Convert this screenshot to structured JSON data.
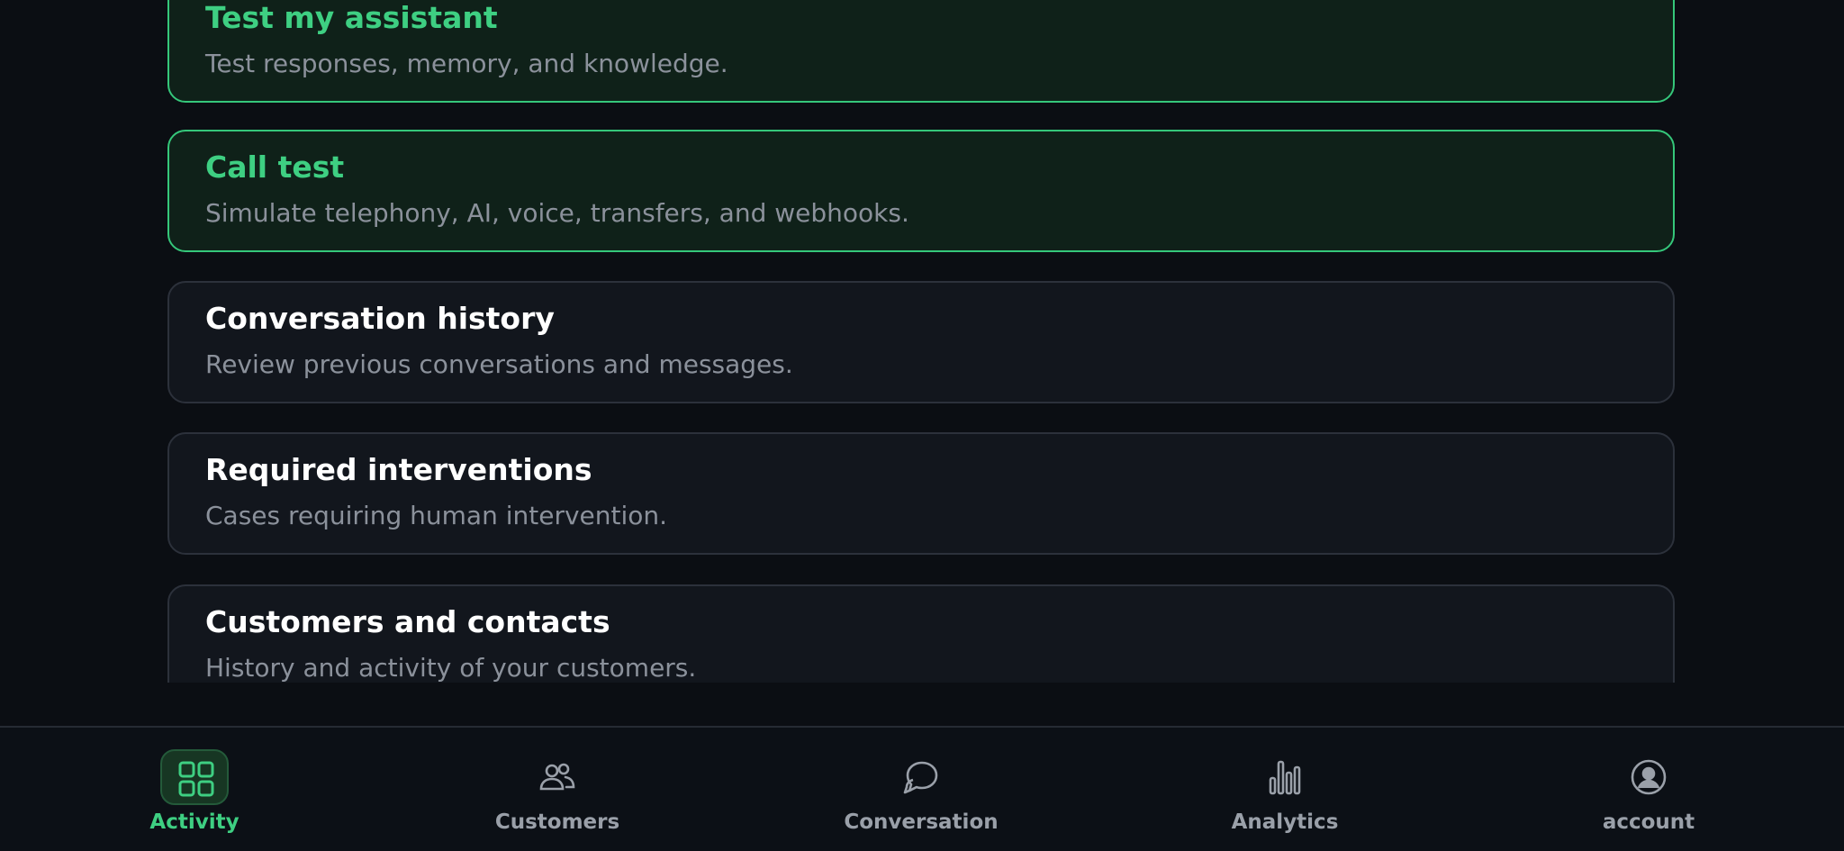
{
  "colors": {
    "accent": "#3ecf82",
    "background": "#0b0e13",
    "card_bg": "#12161d",
    "card_active_bg": "#0f2119",
    "text_primary": "#ffffff",
    "text_secondary": "#8b919b"
  },
  "cards": [
    {
      "title": "Test my assistant",
      "description": "Test responses, memory, and knowledge.",
      "active": true
    },
    {
      "title": "Call test",
      "description": "Simulate telephony, AI, voice, transfers, and webhooks.",
      "active": true
    },
    {
      "title": "Conversation history",
      "description": "Review previous conversations and messages.",
      "active": false
    },
    {
      "title": "Required interventions",
      "description": "Cases requiring human intervention.",
      "active": false
    },
    {
      "title": "Customers and contacts",
      "description": "History and activity of your customers.",
      "active": false
    }
  ],
  "bottom_nav": {
    "items": [
      {
        "label": "Activity",
        "icon": "grid-icon",
        "active": true
      },
      {
        "label": "Customers",
        "icon": "users-icon",
        "active": false
      },
      {
        "label": "Conversation",
        "icon": "chat-bubble-icon",
        "active": false
      },
      {
        "label": "Analytics",
        "icon": "bar-chart-icon",
        "active": false
      },
      {
        "label": "account",
        "icon": "user-circle-icon",
        "active": false
      }
    ]
  }
}
